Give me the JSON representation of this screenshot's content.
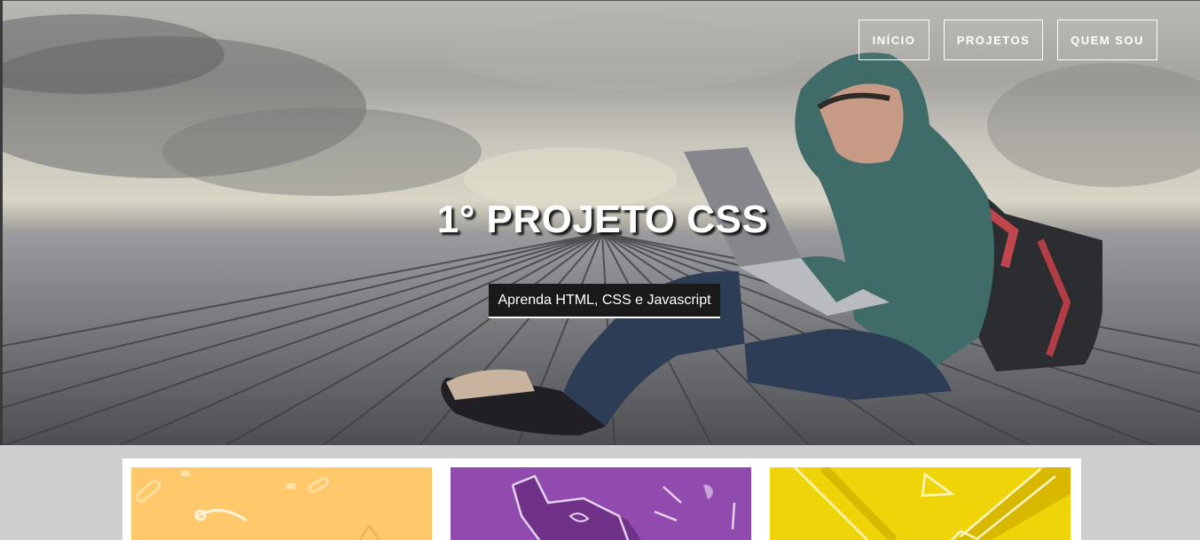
{
  "nav": {
    "items": [
      {
        "label": "INÍCIO"
      },
      {
        "label": "PROJETOS"
      },
      {
        "label": "QUEM SOU"
      }
    ]
  },
  "hero": {
    "title": "1° PROJETO CSS",
    "subtitle": "Aprenda HTML, CSS e Javascript"
  },
  "cards": [
    {
      "icon": "paperclip-compass-icon",
      "color": "#ffc96b"
    },
    {
      "icon": "elephant-icon",
      "color": "#914aad"
    },
    {
      "icon": "pencil-triangle-icon",
      "color": "#f0d40a"
    }
  ]
}
